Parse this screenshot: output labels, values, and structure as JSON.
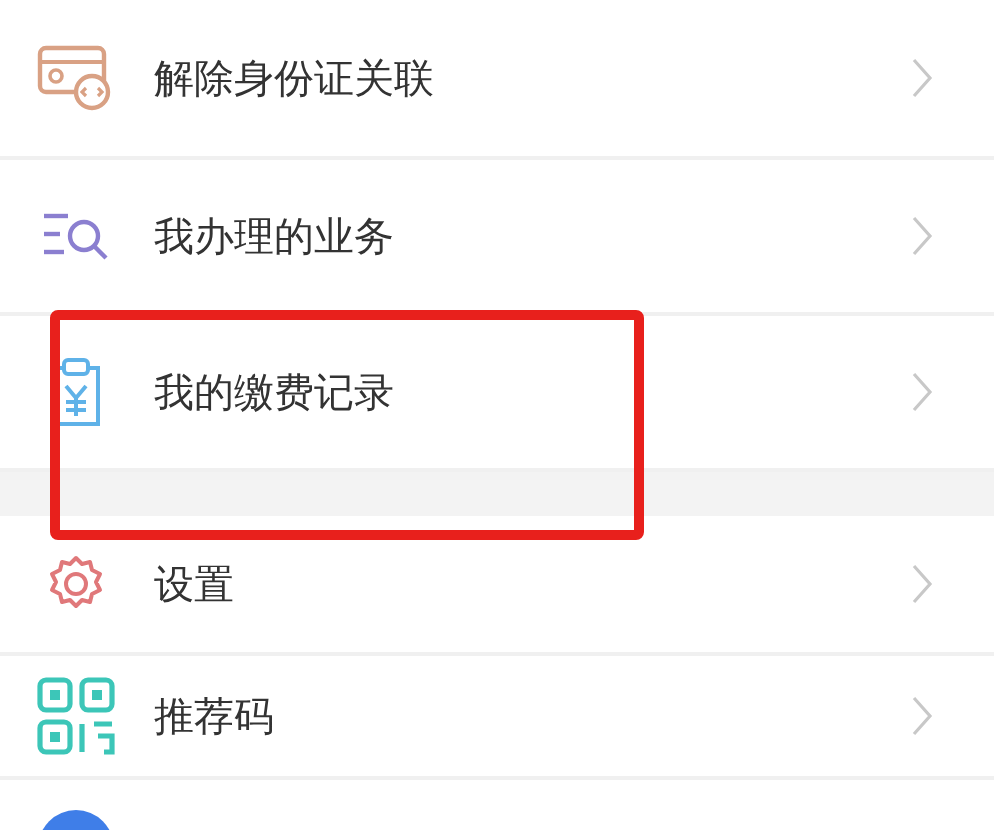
{
  "groups": [
    {
      "items": [
        {
          "kind": "id-card",
          "label": "解除身份证关联",
          "highlight": false
        },
        {
          "kind": "search-list",
          "label": "我办理的业务",
          "highlight": false
        },
        {
          "kind": "receipt",
          "label": "我的缴费记录",
          "highlight": true
        }
      ]
    },
    {
      "items": [
        {
          "kind": "gear",
          "label": "设置",
          "highlight": false
        },
        {
          "kind": "qr",
          "label": "推荐码",
          "highlight": false
        },
        {
          "kind": "circle",
          "highlight": false
        }
      ]
    }
  ]
}
